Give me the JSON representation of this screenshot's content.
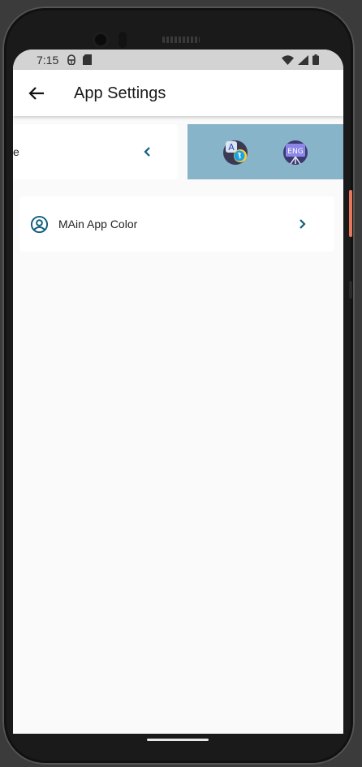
{
  "status_bar": {
    "time": "7:15",
    "left_icons": [
      "android-debug-icon",
      "sd-card-icon"
    ],
    "right_icons": [
      "wifi-icon",
      "signal-icon",
      "battery-icon"
    ]
  },
  "app_bar": {
    "back_icon": "arrow-left-icon",
    "title": "App Settings"
  },
  "slider": {
    "card_text": "e",
    "chevron_icon": "chevron-left-icon",
    "language_icons": [
      "translate-icon",
      "english-board-icon"
    ],
    "panel_color": "#87b4c9"
  },
  "settings": {
    "items": [
      {
        "label": "MAin App Color",
        "icon": "user-circle-icon",
        "chevron_icon": "chevron-right-icon"
      }
    ]
  },
  "colors": {
    "accent": "#0e5d7e",
    "background": "#fafafa",
    "status_bar": "#d3d3d3",
    "power_button": "#e8765a"
  }
}
